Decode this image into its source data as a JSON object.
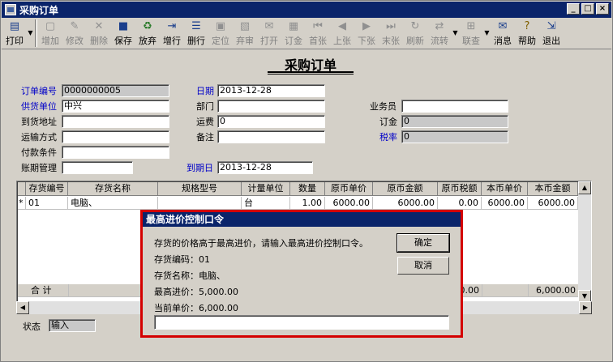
{
  "window": {
    "title": "采购订单"
  },
  "toolbar": {
    "buttons": [
      {
        "label": "打印",
        "icon": "printer-icon",
        "enabled": true
      },
      {
        "label": "增加",
        "icon": "add-icon",
        "enabled": false
      },
      {
        "label": "修改",
        "icon": "edit-icon",
        "enabled": false
      },
      {
        "label": "删除",
        "icon": "delete-icon",
        "enabled": false
      },
      {
        "label": "保存",
        "icon": "save-icon",
        "enabled": true
      },
      {
        "label": "放弃",
        "icon": "abandon-icon",
        "enabled": true
      },
      {
        "label": "增行",
        "icon": "add-row-icon",
        "enabled": true
      },
      {
        "label": "删行",
        "icon": "delete-row-icon",
        "enabled": true
      },
      {
        "label": "定位",
        "icon": "locate-icon",
        "enabled": false
      },
      {
        "label": "弃审",
        "icon": "unaudit-icon",
        "enabled": false
      },
      {
        "label": "打开",
        "icon": "open-icon",
        "enabled": false
      },
      {
        "label": "订金",
        "icon": "deposit-icon",
        "enabled": false
      },
      {
        "label": "首张",
        "icon": "first-icon",
        "enabled": false
      },
      {
        "label": "上张",
        "icon": "prev-icon",
        "enabled": false
      },
      {
        "label": "下张",
        "icon": "next-icon",
        "enabled": false
      },
      {
        "label": "末张",
        "icon": "last-icon",
        "enabled": false
      },
      {
        "label": "刷新",
        "icon": "refresh-icon",
        "enabled": false
      },
      {
        "label": "流转",
        "icon": "flow-icon",
        "enabled": false
      },
      {
        "label": "联查",
        "icon": "query-icon",
        "enabled": false
      },
      {
        "label": "消息",
        "icon": "message-icon",
        "enabled": true
      },
      {
        "label": "帮助",
        "icon": "help-icon",
        "enabled": true
      },
      {
        "label": "退出",
        "icon": "exit-icon",
        "enabled": true
      }
    ]
  },
  "form": {
    "title": "采购订单",
    "order_no_label": "订单编号",
    "order_no": "0000000005",
    "date_label": "日期",
    "date": "2013-12-28",
    "supplier_label": "供货单位",
    "supplier": "中兴",
    "dept_label": "部门",
    "dept": "",
    "salesman_label": "业务员",
    "salesman": "",
    "address_label": "到货地址",
    "address": "",
    "freight_label": "运费",
    "freight": "0",
    "deposit_label": "订金",
    "deposit": "0",
    "transport_label": "运输方式",
    "transport": "",
    "note_label": "备注",
    "note": "",
    "tax_label": "税率",
    "tax": "0",
    "payment_label": "付款条件",
    "payment": "",
    "account_label": "账期管理",
    "account": "",
    "due_label": "到期日",
    "due": "2013-12-28",
    "status_label": "状态",
    "status": "输入"
  },
  "grid": {
    "columns": [
      "存货编号",
      "存货名称",
      "规格型号",
      "计量单位",
      "数量",
      "原币单价",
      "原币金额",
      "原币税额",
      "本币单价",
      "本币金额"
    ],
    "row": {
      "marker": "*",
      "code": "01",
      "name": "电脑、",
      "spec": "",
      "unit": "台",
      "qty": "1.00",
      "price": "6000.00",
      "amount": "6000.00",
      "tax": "0.00",
      "local_price": "6000.00",
      "local_amount": "6000.00"
    },
    "total_label": "合 计",
    "total_tax": "0.00",
    "total_amount": "6,000.00"
  },
  "dialog": {
    "title": "最高进价控制口令",
    "message": "存货的价格高于最高进价，请输入最高进价控制口令。",
    "code_line": "存货编码：01",
    "name_line": "存货名称：电脑、",
    "max_line": "最高进价：5,000.00",
    "cur_line": "当前单价：6,000.00",
    "ok_label": "确定",
    "cancel_label": "取消",
    "password_value": ""
  }
}
